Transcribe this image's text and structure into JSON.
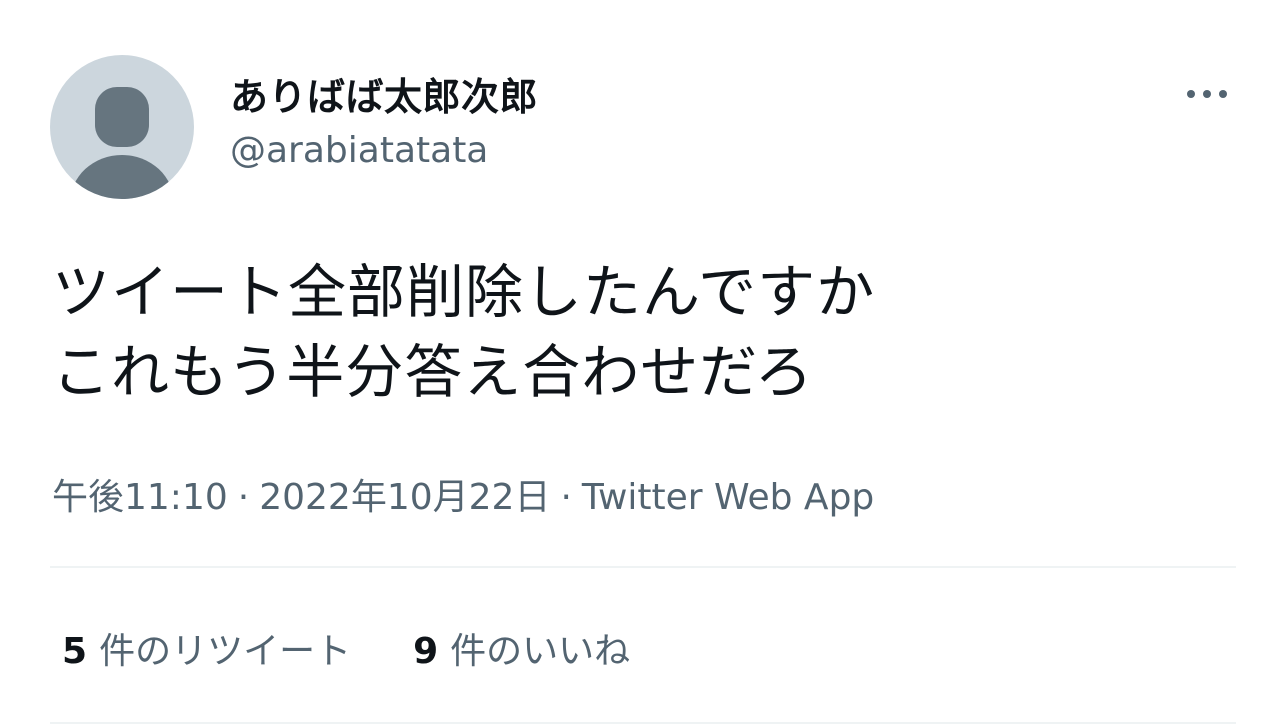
{
  "user": {
    "display_name": "ありばば太郎次郎",
    "handle": "@arabiatatata",
    "avatar_icon": "default-profile-icon"
  },
  "tweet": {
    "text": "ツイート全部削除したんですか\nこれもう半分答え合わせだろ",
    "time": "午後11:10",
    "date": "2022年10月22日",
    "separator": "·",
    "source": "Twitter Web App"
  },
  "stats": {
    "retweets": {
      "count": "5",
      "label": "件のリツイート"
    },
    "likes": {
      "count": "9",
      "label": "件のいいね"
    }
  },
  "icons": {
    "more": "more-horizontal-icon"
  },
  "colors": {
    "text_primary": "#0f1419",
    "text_secondary": "#536471",
    "avatar_bg": "#ccd6dd",
    "avatar_figure": "#66757f",
    "divider": "#eff3f4"
  }
}
